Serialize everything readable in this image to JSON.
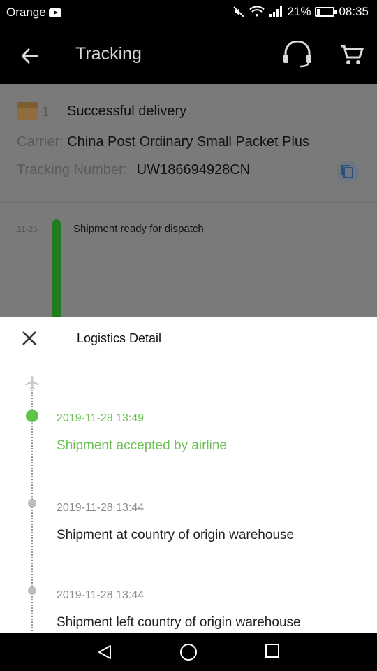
{
  "status_bar": {
    "carrier": "Orange",
    "battery_pct": "21%",
    "battery_level": 0.21,
    "time": "08:35",
    "icons": [
      "youtube-icon",
      "mute-icon",
      "wifi-icon",
      "signal-icon",
      "battery-icon"
    ]
  },
  "app_bar": {
    "title": "Tracking",
    "icons": [
      "back-arrow-icon",
      "customer-support-icon",
      "cart-icon"
    ]
  },
  "package": {
    "count": "1",
    "status": "Successful delivery",
    "carrier_label": "Carrier:",
    "carrier_value": "China Post Ordinary Small Packet Plus",
    "tracking_label": "Tracking Number:",
    "tracking_value": "UW186694928CN"
  },
  "timeline_preview": {
    "date": "11-25",
    "text": "Shipment ready for dispatch"
  },
  "logistics": {
    "title": "Logistics Detail",
    "events": [
      {
        "time": "2019-11-28 13:49",
        "desc": "Shipment accepted by airline"
      },
      {
        "time": "2019-11-28 13:44",
        "desc": "Shipment at country of origin warehouse"
      },
      {
        "time": "2019-11-28 13:44",
        "desc": "Shipment left country of origin warehouse"
      }
    ]
  },
  "colors": {
    "accent_green": "#6bc154",
    "status_green": "#1f7d1d"
  }
}
